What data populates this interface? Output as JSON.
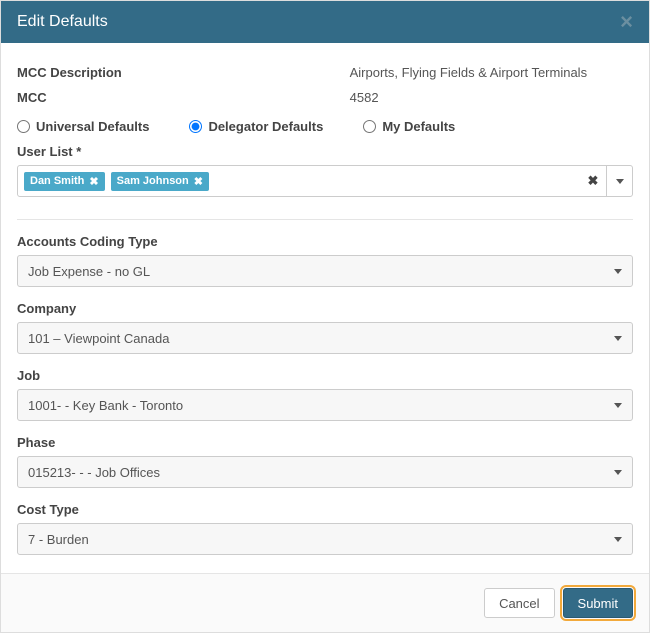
{
  "modal": {
    "title": "Edit Defaults",
    "close_glyph": "×"
  },
  "info": {
    "mcc_desc_label": "MCC Description",
    "mcc_desc_value": "Airports, Flying Fields & Airport Terminals",
    "mcc_label": "MCC",
    "mcc_value": "4582"
  },
  "defaults": {
    "options": [
      {
        "label": "Universal Defaults",
        "checked": false
      },
      {
        "label": "Delegator Defaults",
        "checked": true
      },
      {
        "label": "My Defaults",
        "checked": false
      }
    ]
  },
  "userlist": {
    "label": "User List *",
    "tags": [
      "Dan Smith",
      "Sam Johnson"
    ],
    "tag_remove_glyph": "✖",
    "clear_glyph": "✖"
  },
  "fields": {
    "accounts_coding_type": {
      "label": "Accounts Coding Type",
      "value": "Job Expense - no GL"
    },
    "company": {
      "label": "Company",
      "value": "101 – Viewpoint Canada"
    },
    "job": {
      "label": "Job",
      "value": "1001- - Key Bank - Toronto"
    },
    "phase": {
      "label": "Phase",
      "value": "015213- - - Job Offices"
    },
    "cost_type": {
      "label": "Cost Type",
      "value": "7 - Burden"
    }
  },
  "footer": {
    "cancel": "Cancel",
    "submit": "Submit"
  }
}
